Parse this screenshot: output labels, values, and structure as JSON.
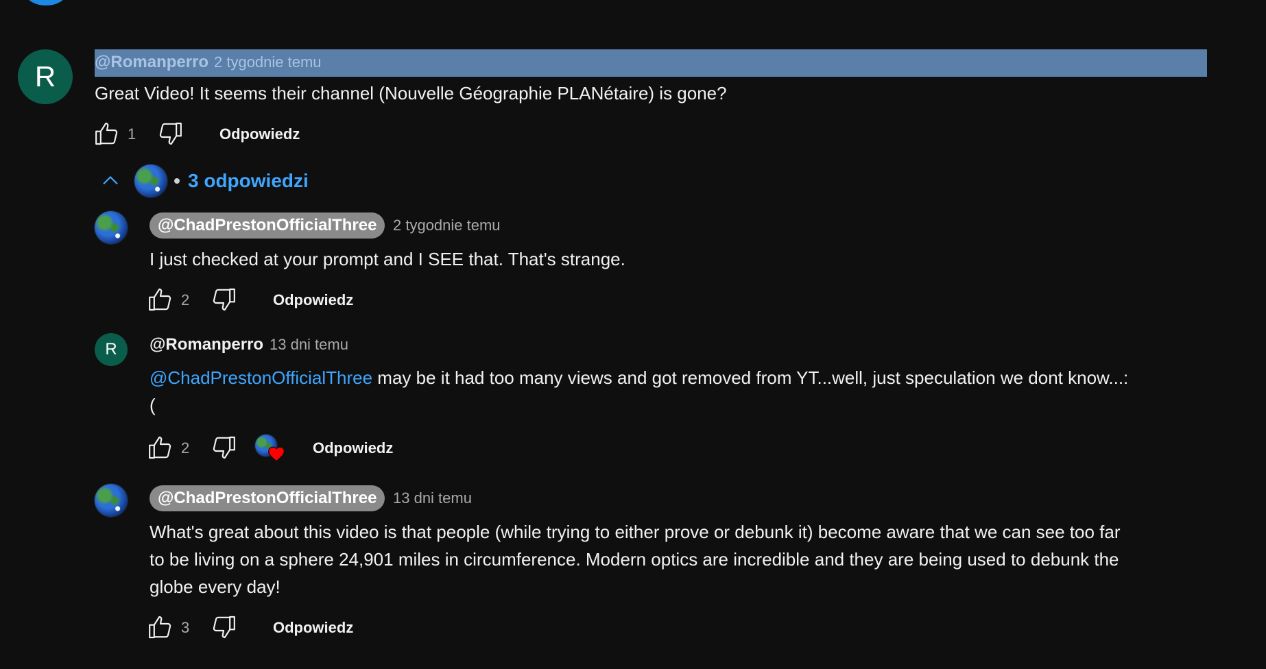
{
  "main_comment": {
    "author": "@Romanperro",
    "time": "2 tygodnie temu",
    "avatar_letter": "R",
    "text": "Great Video! It seems their channel (Nouvelle Géographie PLANétaire) is gone?",
    "likes": "1",
    "reply_label": "Odpowiedz"
  },
  "replies_toggle": {
    "label": "3 odpowiedzi"
  },
  "replies": [
    {
      "author": "@ChadPrestonOfficialThree",
      "time": "2 tygodnie temu",
      "text": "I just checked at your prompt and I SEE that.  That's strange.",
      "likes": "2",
      "reply_label": "Odpowiedz"
    },
    {
      "author": "@Romanperro",
      "avatar_letter": "R",
      "time": "13 dni temu",
      "mention": "@ChadPrestonOfficialThree",
      "text_line1": " may be it had too many views and got removed from YT...well, just speculation we dont know...:",
      "text_line2": "(",
      "likes": "2",
      "reply_label": "Odpowiedz"
    },
    {
      "author": "@ChadPrestonOfficialThree",
      "time": "13 dni temu",
      "text_line1": "What's great about this video is that people (while trying to either prove or debunk it) become aware that we can see too far",
      "text_line2": "to be living on a sphere 24,901 miles in circumference.  Modern optics are incredible and they are being used to debunk the",
      "text_line3": "globe every day!",
      "likes": "3",
      "reply_label": "Odpowiedz"
    }
  ],
  "colors": {
    "background": "#0f0f0f",
    "link": "#3ea6ff",
    "selection": "#5a7fa8",
    "avatar": "#0b5d4b",
    "heart": "#ff0000"
  },
  "icons": [
    "thumb-up-icon",
    "thumb-down-icon",
    "chevron-up-icon",
    "heart-icon"
  ]
}
